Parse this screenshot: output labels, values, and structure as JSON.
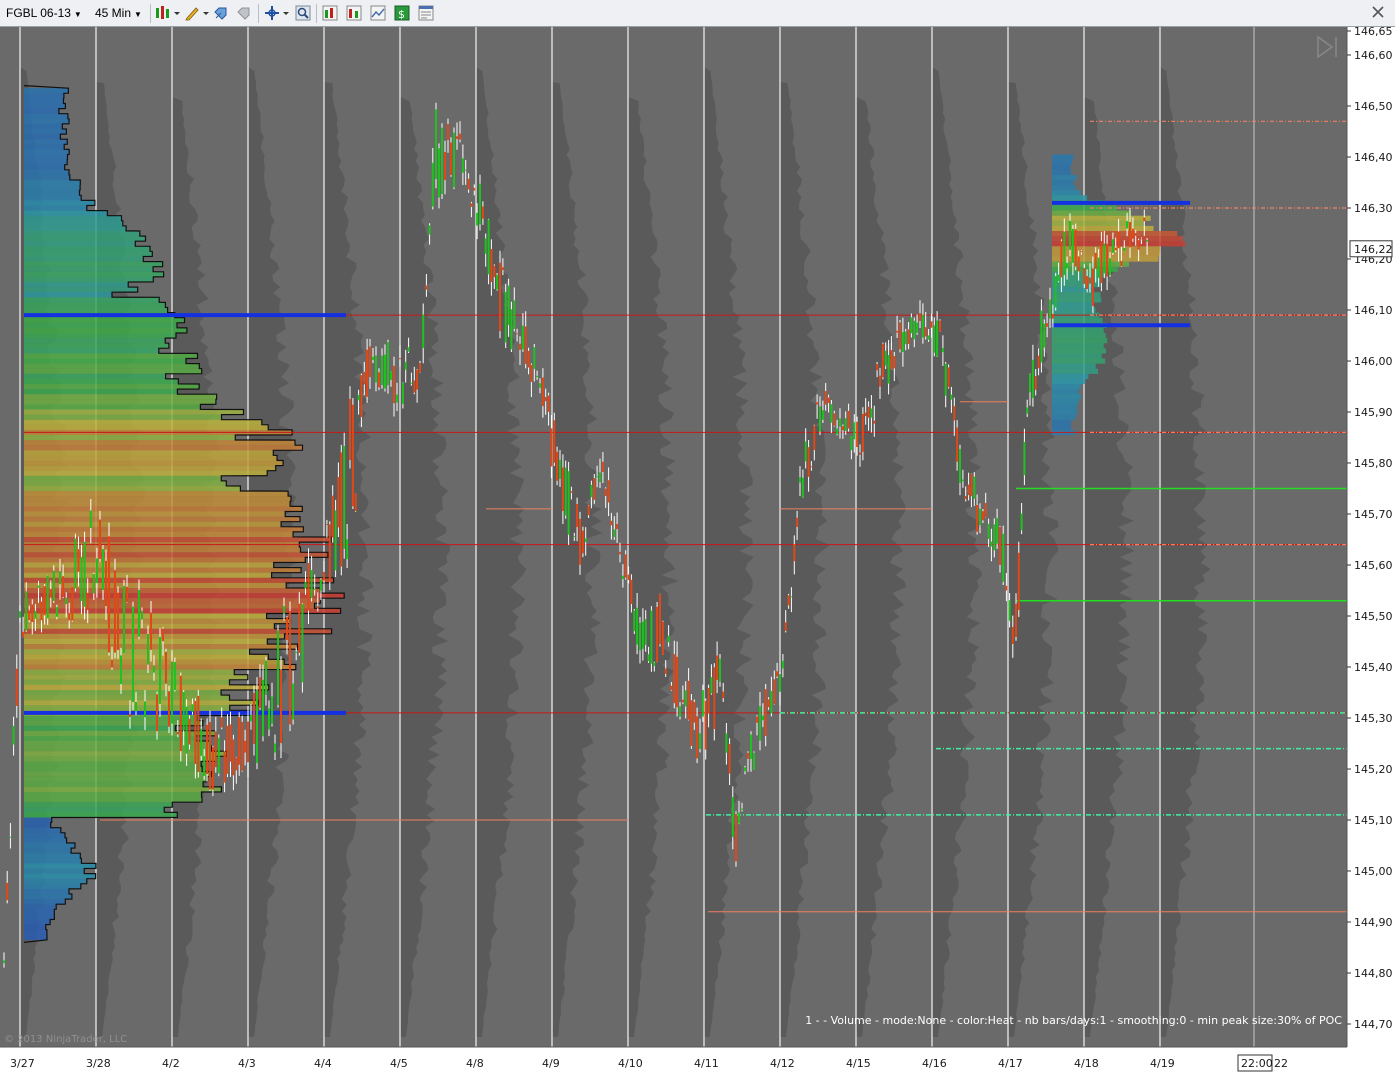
{
  "toolbar": {
    "instrument": "FGBL 06-13",
    "interval": "45 Min",
    "icons": [
      "bar-chart-style-icon",
      "pencil-draw-icon",
      "rocket-icon",
      "rocket-disabled-icon",
      "crosshair-icon",
      "zoom-icon",
      "indicators-icon",
      "strategies-icon",
      "chart-template-icon",
      "money-icon",
      "properties-icon"
    ]
  },
  "chart": {
    "background": "#6a6a6a",
    "price_labels": [
      "146,65",
      "146,60",
      "146,50",
      "146,40",
      "146,30",
      "146,20",
      "146,10",
      "146,00",
      "145,90",
      "145,80",
      "145,70",
      "145,60",
      "145,50",
      "145,40",
      "145,30",
      "145,20",
      "145,10",
      "145,00",
      "144,90",
      "144,80",
      "144,70"
    ],
    "current_price": "146,22",
    "date_labels": [
      "3/27",
      "3/28",
      "4/2",
      "4/3",
      "4/4",
      "4/5",
      "4/8",
      "4/9",
      "4/10",
      "4/11",
      "4/12",
      "4/15",
      "4/16",
      "4/17",
      "4/18",
      "4/19"
    ],
    "time_marker": "22:00",
    "time_marker_suffix": "22",
    "indicator_text": "1 -  - Volume - mode:None - color:Heat - nb bars/days:1 - smoothing:0 - min peak size:30% of POC",
    "copyright": "© 2013 NinjaTrader, LLC",
    "colors": {
      "poc_line": "#1530e0",
      "level_red": "#c81818",
      "level_orange": "#f08060",
      "level_green": "#20e020",
      "level_lightgreen": "#40f0a0",
      "candle_up": "#20c020",
      "candle_down": "#e04818",
      "wick": "#ffffff"
    }
  }
}
